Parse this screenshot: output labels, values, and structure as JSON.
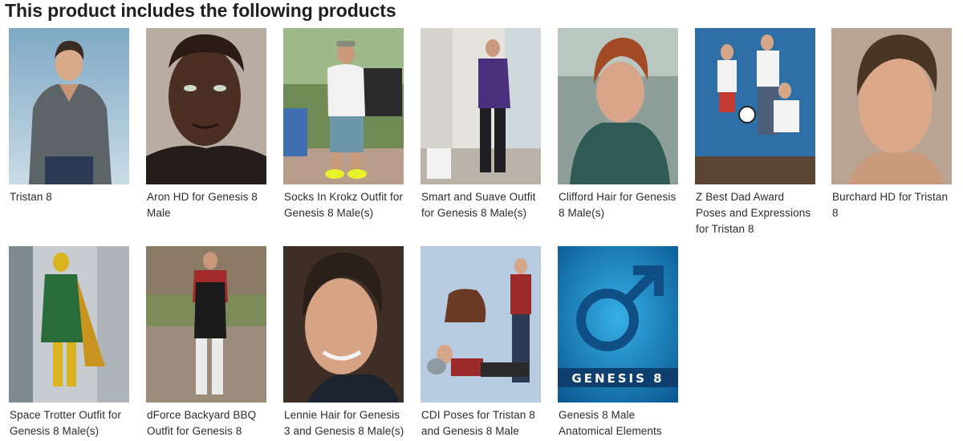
{
  "heading": "This product includes the following products",
  "products": [
    {
      "title": "Tristan 8",
      "image": "tristan-8-thumbnail"
    },
    {
      "title": "Aron HD for Genesis 8 Male",
      "image": "aron-hd-thumbnail"
    },
    {
      "title": "Socks In Krokz Outfit for Genesis 8 Male(s)",
      "image": "socks-in-krokz-thumbnail"
    },
    {
      "title": "Smart and Suave Outfit for Genesis 8 Male(s)",
      "image": "smart-and-suave-thumbnail"
    },
    {
      "title": "Clifford Hair for Genesis 8 Male(s)",
      "image": "clifford-hair-thumbnail"
    },
    {
      "title": "Z Best Dad Award Poses and Expressions for Tristan 8",
      "image": "best-dad-award-thumbnail"
    },
    {
      "title": "Burchard HD for Tristan 8",
      "image": "burchard-hd-thumbnail"
    },
    {
      "title": "Space Trotter Outfit for Genesis 8 Male(s)",
      "image": "space-trotter-thumbnail"
    },
    {
      "title": "dForce Backyard BBQ Outfit for Genesis 8",
      "image": "backyard-bbq-thumbnail"
    },
    {
      "title": "Lennie Hair for Genesis 3 and Genesis 8 Male(s)",
      "image": "lennie-hair-thumbnail"
    },
    {
      "title": "CDI Poses for Tristan 8 and Genesis 8 Male",
      "image": "cdi-poses-thumbnail"
    },
    {
      "title": "Genesis 8 Male Anatomical Elements",
      "image": "genesis-8-anatomical-thumbnail",
      "overlay": "GENESIS 8"
    }
  ]
}
